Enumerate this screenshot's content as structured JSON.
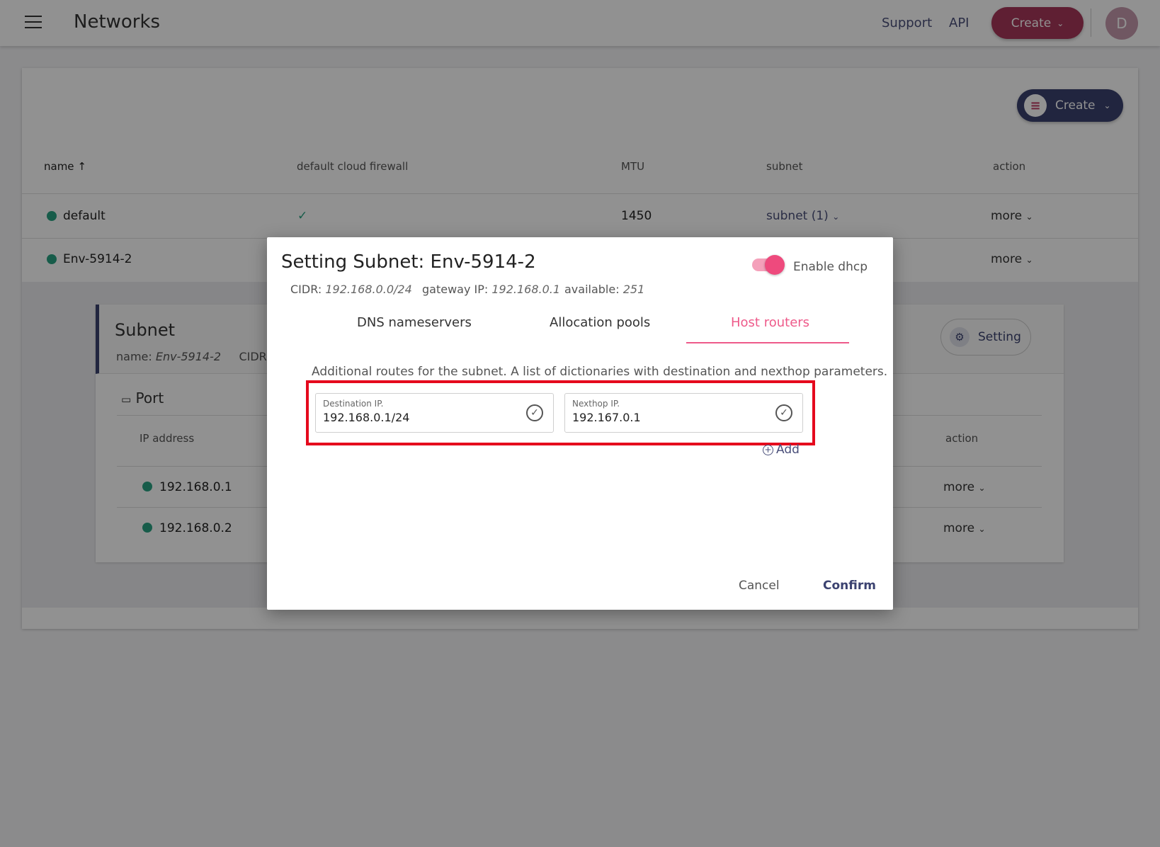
{
  "topbar": {
    "title": "Networks",
    "support_label": "Support",
    "api_label": "API",
    "create_label": "Create",
    "avatar_initial": "D",
    "menu_icon": "hamburger-icon"
  },
  "panel": {
    "create_label": "Create",
    "columns": [
      "name",
      "default cloud firewall",
      "MTU",
      "subnet",
      "action"
    ],
    "rows": [
      {
        "name": "default",
        "firewall": "✓",
        "mtu": "1450",
        "subnet": "subnet (1)",
        "action": "more"
      },
      {
        "name": "Env-5914-2",
        "action": "more"
      }
    ]
  },
  "subnet_card": {
    "title": "Subnet",
    "name_label": "name:",
    "name_value": "Env-5914-2",
    "cidr_label": "CIDR:",
    "setting_label": "Setting",
    "port_title": "Port",
    "port_columns": [
      "IP address",
      "action"
    ],
    "ports": [
      {
        "ip": "192.168.0.1",
        "action": "more"
      },
      {
        "ip": "192.168.0.2",
        "action": "more"
      }
    ]
  },
  "dialog": {
    "title": "Setting Subnet: Env-5914-2",
    "cidr_label": "CIDR:",
    "cidr_value": "192.168.0.0/24",
    "gateway_label": "gateway IP:",
    "gateway_value": "192.168.0.1",
    "available_label": "available:",
    "available_value": "251",
    "dhcp_label": "Enable dhcp",
    "dhcp_enabled": true,
    "tabs": [
      "DNS nameservers",
      "Allocation pools",
      "Host routers"
    ],
    "active_tab": "Host routers",
    "description": "Additional routes for the subnet. A list of dictionaries with destination and nexthop parameters.",
    "destination_label": "Destination IP.",
    "destination_value": "192.168.0.1/24",
    "nexthop_label": "Nexthop IP.",
    "nexthop_value": "192.167.0.1",
    "add_label": "Add",
    "cancel_label": "Cancel",
    "confirm_label": "Confirm"
  },
  "colors": {
    "accent_pink": "#ee5a8a",
    "navy": "#3b4270",
    "status_green": "#2aa383",
    "highlight_red": "#e5091d"
  }
}
